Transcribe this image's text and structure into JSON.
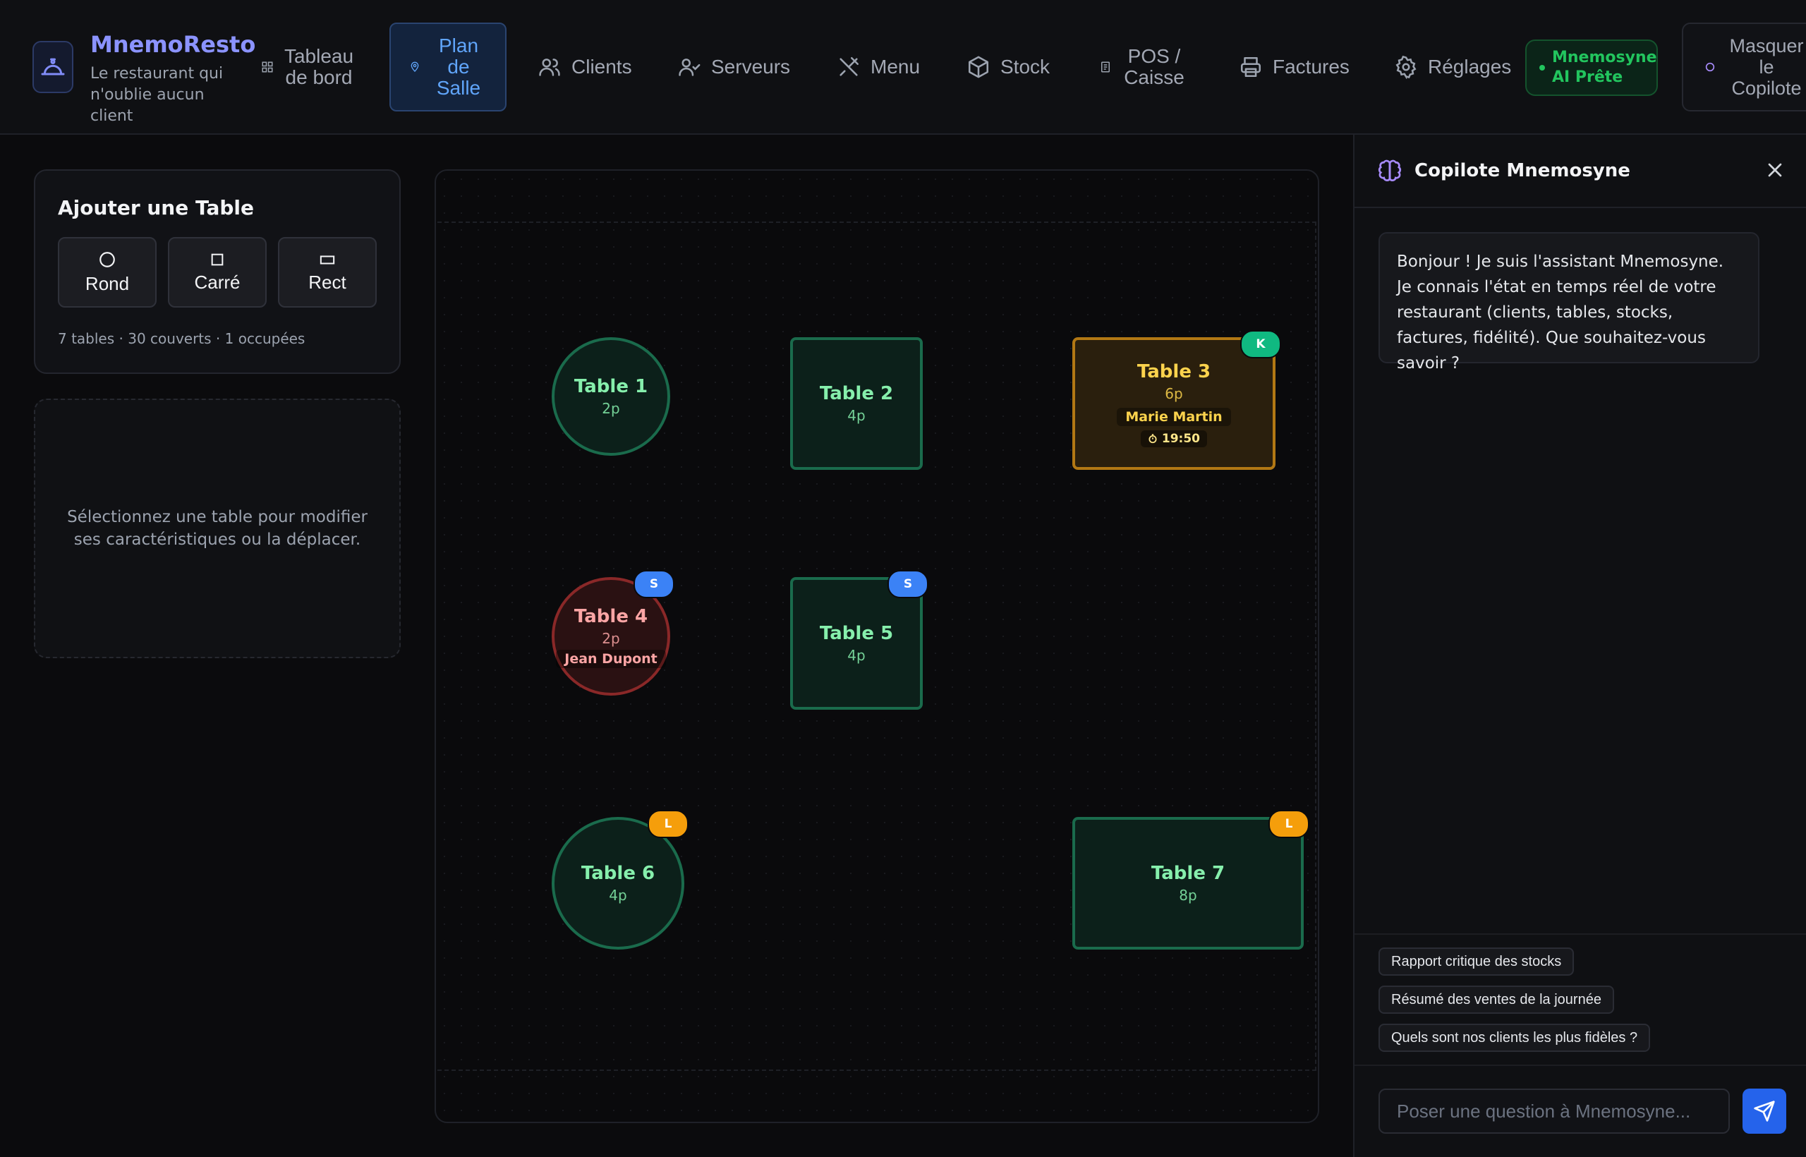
{
  "brand": {
    "name": "MnemoResto",
    "tagline": "Le restaurant qui n'oublie aucun client"
  },
  "nav": {
    "items": [
      {
        "label": "Tableau de bord",
        "icon": "grid-icon"
      },
      {
        "label": "Plan de Salle",
        "icon": "map-pin-icon",
        "active": true
      },
      {
        "label": "Clients",
        "icon": "users-icon"
      },
      {
        "label": "Serveurs",
        "icon": "user-check-icon"
      },
      {
        "label": "Menu",
        "icon": "utensils-icon"
      },
      {
        "label": "Stock",
        "icon": "package-icon"
      },
      {
        "label": "POS / Caisse",
        "icon": "receipt-icon"
      },
      {
        "label": "Factures",
        "icon": "printer-icon"
      },
      {
        "label": "Réglages",
        "icon": "gear-icon"
      }
    ],
    "ai_status": "Mnemosyne AI Prête",
    "hide_copilot": "Masquer le Copilote"
  },
  "add_table": {
    "title": "Ajouter une Table",
    "shapes": [
      {
        "label": "Rond",
        "icon": "circle-icon"
      },
      {
        "label": "Carré",
        "icon": "square-icon"
      },
      {
        "label": "Rect",
        "icon": "rectangle-icon"
      }
    ],
    "stats": "7 tables · 30 couverts · 1 occupées"
  },
  "selection_hint": "Sélectionnez une table pour modifier ses caractéristiques ou la déplacer.",
  "floor": {
    "tables": [
      {
        "name": "Table 1",
        "seats": "2p",
        "shape": "round",
        "status": "free"
      },
      {
        "name": "Table 2",
        "seats": "4p",
        "shape": "square",
        "status": "free"
      },
      {
        "name": "Table 3",
        "seats": "6p",
        "shape": "rect",
        "status": "reserved",
        "guest": "Marie Martin",
        "time": "19:50",
        "badge": "K"
      },
      {
        "name": "Table 4",
        "seats": "2p",
        "shape": "round",
        "status": "occupied",
        "guest": "Jean Dupont",
        "badge": "S"
      },
      {
        "name": "Table 5",
        "seats": "4p",
        "shape": "square",
        "status": "free",
        "badge": "S"
      },
      {
        "name": "Table 6",
        "seats": "4p",
        "shape": "round",
        "status": "free",
        "badge": "L"
      },
      {
        "name": "Table 7",
        "seats": "8p",
        "shape": "rect",
        "status": "free",
        "badge": "L"
      }
    ]
  },
  "colors": {
    "accent": "#60a5fa",
    "free": "#1a6b4c",
    "reserved": "#b27814",
    "occupied": "#8a2828",
    "badge_k": "#10b981",
    "badge_s": "#3b82f6",
    "badge_l": "#f59e0b"
  },
  "copilot": {
    "title": "Copilote Mnemosyne",
    "welcome": "Bonjour ! Je suis l'assistant Mnemosyne. Je connais l'état en temps réel de votre restaurant (clients, tables, stocks, factures, fidélité). Que souhaitez-vous savoir ?",
    "suggestions": [
      "Rapport critique des stocks",
      "Résumé des ventes de la journée",
      "Quels sont nos clients les plus fidèles ?"
    ],
    "input_placeholder": "Poser une question à Mnemosyne..."
  }
}
